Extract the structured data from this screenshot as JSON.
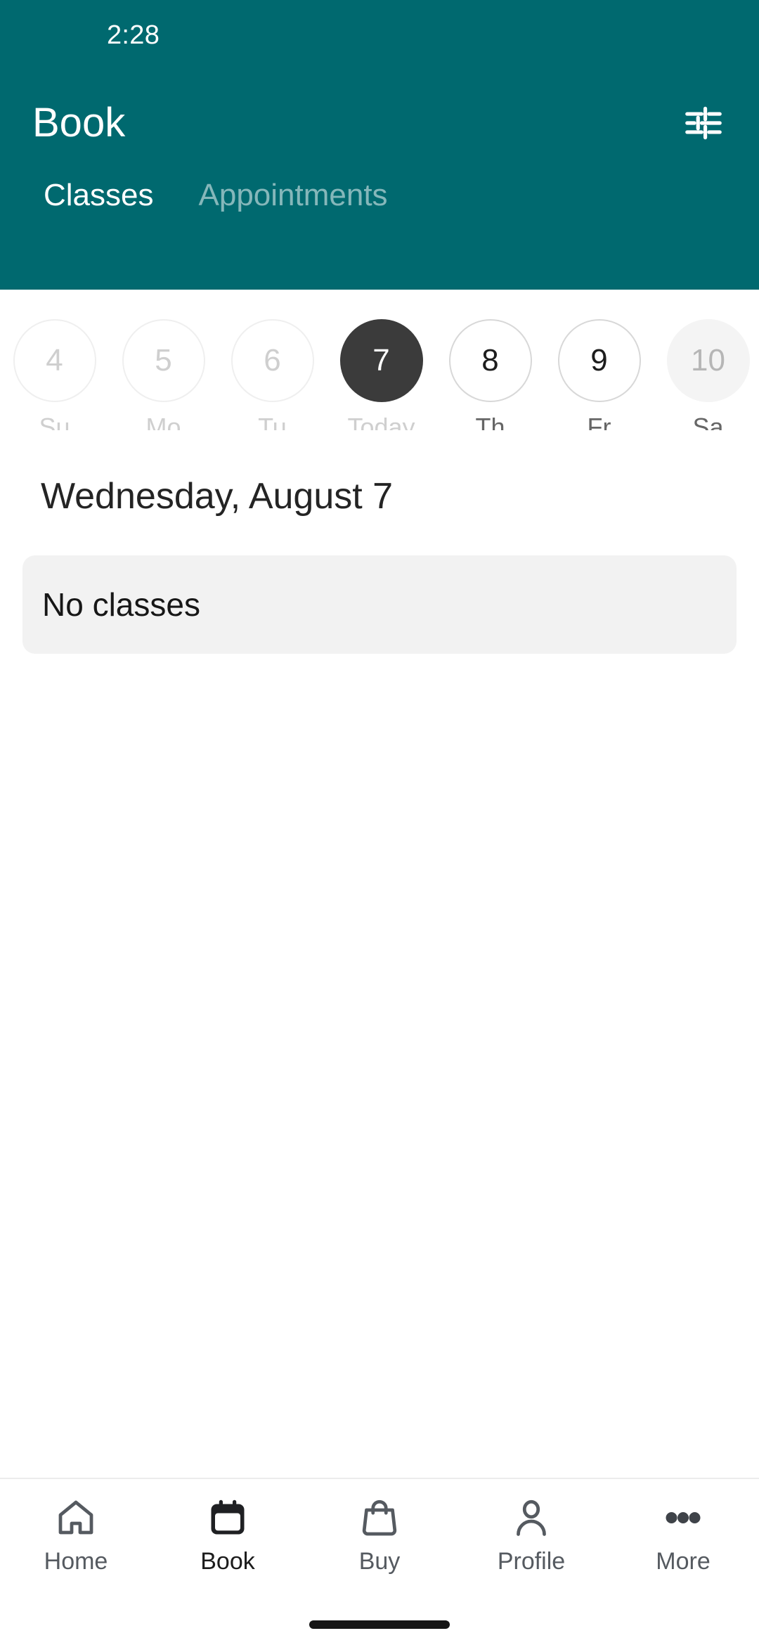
{
  "status_bar": {
    "time": "2:28"
  },
  "app_bar": {
    "title": "Book",
    "filter_icon": "tune-icon"
  },
  "tabs": [
    {
      "label": "Classes",
      "active": true
    },
    {
      "label": "Appointments",
      "active": false
    }
  ],
  "date_strip": {
    "days": [
      {
        "date": "4",
        "weekday": "Su",
        "state": "past"
      },
      {
        "date": "5",
        "weekday": "Mo",
        "state": "past"
      },
      {
        "date": "6",
        "weekday": "Tu",
        "state": "past"
      },
      {
        "date": "7",
        "weekday": "Today",
        "state": "selected"
      },
      {
        "date": "8",
        "weekday": "Th",
        "state": "future"
      },
      {
        "date": "9",
        "weekday": "Fr",
        "state": "future"
      },
      {
        "date": "10",
        "weekday": "Sa",
        "state": "filled"
      }
    ]
  },
  "main": {
    "date_heading": "Wednesday, August 7",
    "empty_state": "No classes"
  },
  "bottom_nav": [
    {
      "label": "Home",
      "icon": "home-icon",
      "active": false
    },
    {
      "label": "Book",
      "icon": "calendar-icon",
      "active": true
    },
    {
      "label": "Buy",
      "icon": "bag-icon",
      "active": false
    },
    {
      "label": "Profile",
      "icon": "person-icon",
      "active": false
    },
    {
      "label": "More",
      "icon": "ellipsis-icon",
      "active": false
    }
  ],
  "colors": {
    "brand_teal": "#00696F",
    "selected_day": "#3b3b3b",
    "empty_card_bg": "#f2f2f2",
    "nav_inactive": "#555a60",
    "nav_active": "#1c1c1c"
  }
}
